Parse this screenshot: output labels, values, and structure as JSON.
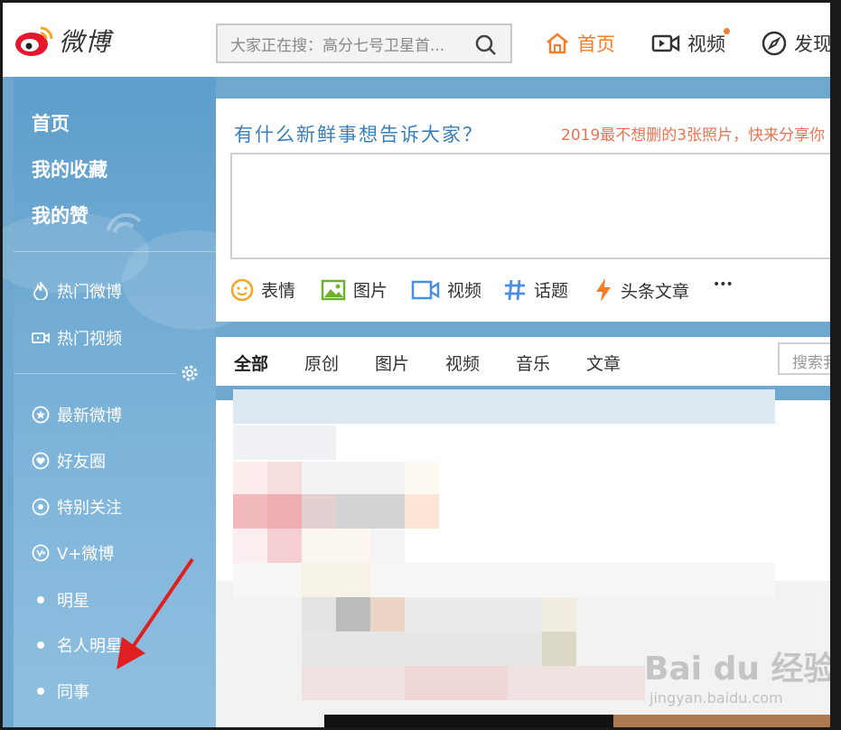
{
  "brand": {
    "name": "微博"
  },
  "search": {
    "placeholder": "大家正在搜：高分七号卫星首..."
  },
  "nav": {
    "home": "首页",
    "video": "视频",
    "discover": "发现"
  },
  "sidebar": {
    "primary": [
      "首页",
      "我的收藏",
      "我的赞"
    ],
    "hot": [
      "热门微博",
      "热门视频"
    ],
    "groups": [
      "最新微博",
      "好友圈",
      "特别关注",
      "V+微博"
    ],
    "bullets": [
      "明星",
      "名人明星",
      "同事"
    ]
  },
  "publisher": {
    "prompt": "有什么新鲜事想告诉大家？",
    "ad": "2019最不想删的3张照片，快来分享你",
    "tools": [
      "表情",
      "图片",
      "视频",
      "话题",
      "头条文章"
    ],
    "more": "•••"
  },
  "feed_tabs": {
    "tabs": [
      "全部",
      "原创",
      "图片",
      "视频",
      "音乐",
      "文章"
    ],
    "search_placeholder": "搜索我"
  },
  "watermark": {
    "logo": "Bai du 经验",
    "url": "jingyan.baidu.com"
  },
  "colors": {
    "accent": "#f57c29",
    "sidebar": "#6fa8cf",
    "link": "#3a7fb8",
    "ad": "#eb7350",
    "annotation_arrow": "#e02020"
  }
}
